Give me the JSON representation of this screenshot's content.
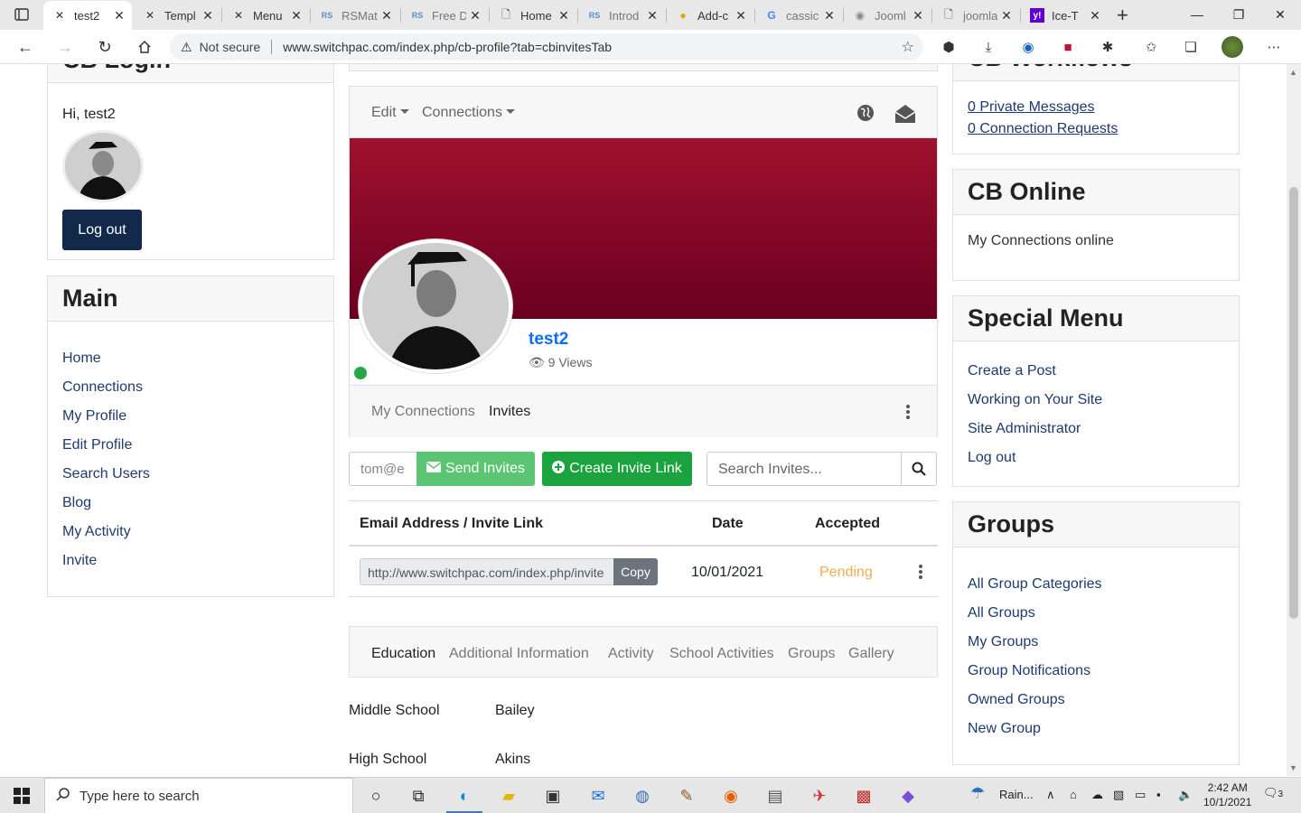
{
  "browser": {
    "tabs": [
      {
        "label": "test2",
        "icon": "joomla-icon",
        "active": true
      },
      {
        "label": "Templ",
        "icon": "joomla-icon"
      },
      {
        "label": "Menu",
        "icon": "joomla-icon"
      },
      {
        "label": "RSMat",
        "icon": "rs-icon"
      },
      {
        "label": "Free D",
        "icon": "rs-icon"
      },
      {
        "label": "Home",
        "icon": "page-icon"
      },
      {
        "label": "Introd",
        "icon": "rs-icon"
      },
      {
        "label": "Add-c",
        "icon": "addon-icon"
      },
      {
        "label": "cassic",
        "icon": "google-icon"
      },
      {
        "label": "Jooml",
        "icon": "globe-icon"
      },
      {
        "label": "joomla",
        "icon": "page-icon"
      },
      {
        "label": "Ice-T",
        "icon": "yahoo-icon"
      }
    ],
    "address": {
      "security": "Not secure",
      "url": "www.switchpac.com/index.php/cb-profile?tab=cbinvitesTab"
    }
  },
  "left": {
    "login": {
      "title": "CB Login",
      "greeting": "Hi, test2",
      "logout": "Log out"
    },
    "main": {
      "title": "Main",
      "items": [
        "Home",
        "Connections",
        "My Profile",
        "Edit Profile",
        "Search Users",
        "Blog",
        "My Activity",
        "Invite"
      ]
    }
  },
  "profile": {
    "menu": {
      "edit": "Edit",
      "connections": "Connections"
    },
    "name": "test2",
    "views": "9 Views",
    "tabs": {
      "connections": "My Connections",
      "invites": "Invites"
    },
    "invites": {
      "email_placeholder": "tom@e",
      "send": "Send Invites",
      "create": "Create Invite Link",
      "search_placeholder": "Search Invites...",
      "columns": [
        "Email Address / Invite Link",
        "Date",
        "Accepted"
      ],
      "rows": [
        {
          "link": "http://www.switchpac.com/index.php/invite",
          "copy": "Copy",
          "date": "10/01/2021",
          "status": "Pending"
        }
      ]
    },
    "info_tabs": [
      "Education",
      "Additional Information",
      "Activity",
      "School Activities",
      "Groups",
      "Gallery"
    ],
    "fields": [
      {
        "label": "Middle School",
        "value": "Bailey"
      },
      {
        "label": "High School",
        "value": "Akins"
      }
    ]
  },
  "right": {
    "workflows": {
      "title": "CB Workflows",
      "items": [
        "0 Private Messages",
        "0 Connection Requests"
      ]
    },
    "online": {
      "title": "CB Online",
      "text": "My Connections online"
    },
    "special": {
      "title": "Special Menu",
      "items": [
        "Create a Post",
        "Working on Your Site",
        "Site Administrator",
        "Log out"
      ]
    },
    "groups": {
      "title": "Groups",
      "items": [
        "All Group Categories",
        "All Groups",
        "My Groups",
        "Group Notifications",
        "Owned Groups",
        "New Group"
      ]
    }
  },
  "taskbar": {
    "search_placeholder": "Type here to search",
    "weather": "Rain...",
    "time": "2:42 AM",
    "date": "10/1/2021",
    "notifications": "3"
  },
  "colors": {
    "banner_top": "#a0102f",
    "banner_bottom": "#6b0020",
    "navy_button": "#13294b",
    "green": "#1aa33f",
    "pending": "#f0ad4e",
    "link": "#1e3a6e",
    "name_blue": "#0d6efd"
  }
}
